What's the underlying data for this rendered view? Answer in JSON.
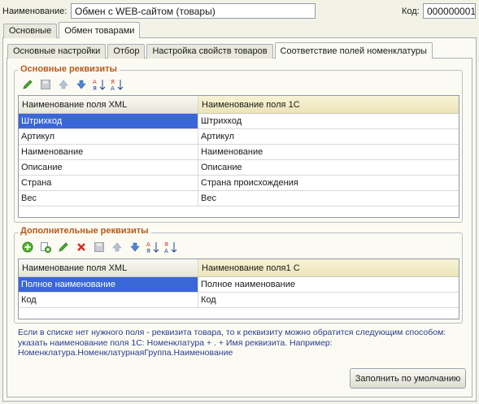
{
  "header": {
    "name_label": "Наименование:",
    "name_value": "Обмен с WEB-сайтом (товары)",
    "code_label": "Код:",
    "code_value": "000000001"
  },
  "main_tabs": [
    {
      "label": "Основные"
    },
    {
      "label": "Обмен товарами"
    }
  ],
  "inner_tabs": [
    {
      "label": "Основные настройки"
    },
    {
      "label": "Отбор"
    },
    {
      "label": "Настройка свойств товаров"
    },
    {
      "label": "Соответствие полей номенклатуры"
    }
  ],
  "basic": {
    "title": "Основные реквизиты",
    "toolbar": [
      "edit-icon",
      "save-icon",
      "move-up-icon",
      "move-down-icon",
      "sort-asc-icon",
      "sort-desc-icon"
    ],
    "headers": [
      "Наименование поля XML",
      "Наименование поля 1С"
    ],
    "rows": [
      [
        "Штрихкод",
        "Штрихкод"
      ],
      [
        "Артикул",
        "Артикул"
      ],
      [
        "Наименование",
        "Наименование"
      ],
      [
        "Описание",
        "Описание"
      ],
      [
        "Страна",
        "Страна происхождения"
      ],
      [
        "Вес",
        "Вес"
      ]
    ]
  },
  "extra": {
    "title": "Дополнительные реквизиты",
    "toolbar": [
      "add-icon",
      "copy-icon",
      "edit-icon",
      "delete-icon",
      "save-icon",
      "move-up-icon",
      "move-down-icon",
      "sort-asc-icon",
      "sort-desc-icon"
    ],
    "headers": [
      "Наименование поля XML",
      "Наименование поля1 С"
    ],
    "rows": [
      [
        "Полное наименование",
        "Полное наименование"
      ],
      [
        "Код",
        "Код"
      ]
    ]
  },
  "hint": "Если в списке нет нужного поля - реквизита товара, то к реквизиту можно обратится следующим способом: указать наименование поля 1С: Номенклатура + . + Имя реквизита. Например: Номенклатура.НоменклатурнаяГруппа.Наименование",
  "fill_default_label": "Заполнить по умолчанию"
}
